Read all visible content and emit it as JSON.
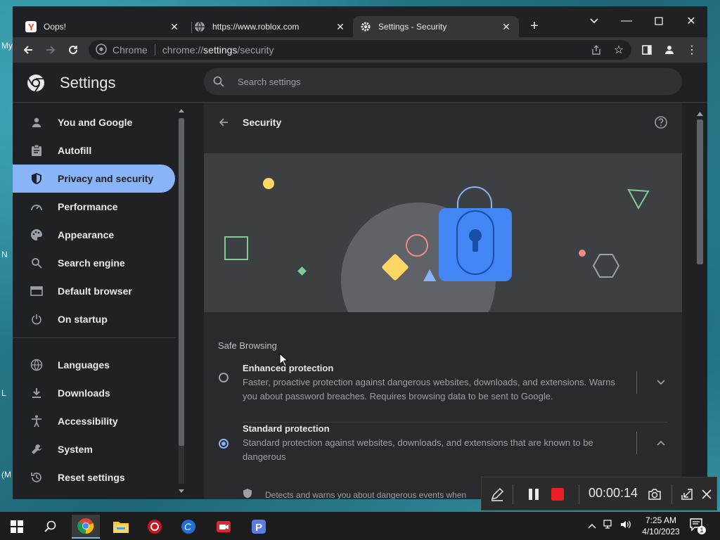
{
  "desktop": {
    "labels": [
      "My",
      "N",
      "L",
      "(M"
    ]
  },
  "tabs": [
    {
      "title": "Oops!",
      "icon": "yandex-icon"
    },
    {
      "title": "https://www.roblox.com",
      "icon": "globe-icon"
    },
    {
      "title": "Settings - Security",
      "icon": "gear-icon",
      "active": true
    }
  ],
  "omnibox": {
    "chip": "Chrome",
    "url_scheme": "chrome://",
    "url_host": "settings",
    "url_path": "/security"
  },
  "settings": {
    "title": "Settings",
    "search_placeholder": "Search settings"
  },
  "sidebar": {
    "items": [
      {
        "label": "You and Google",
        "icon": "person-icon"
      },
      {
        "label": "Autofill",
        "icon": "clipboard-icon"
      },
      {
        "label": "Privacy and security",
        "icon": "shield-icon",
        "selected": true
      },
      {
        "label": "Performance",
        "icon": "speedometer-icon"
      },
      {
        "label": "Appearance",
        "icon": "palette-icon"
      },
      {
        "label": "Search engine",
        "icon": "search-icon"
      },
      {
        "label": "Default browser",
        "icon": "browser-icon"
      },
      {
        "label": "On startup",
        "icon": "power-icon"
      },
      {
        "label": "Languages",
        "icon": "globe-icon"
      },
      {
        "label": "Downloads",
        "icon": "download-icon"
      },
      {
        "label": "Accessibility",
        "icon": "accessibility-icon"
      },
      {
        "label": "System",
        "icon": "wrench-icon"
      },
      {
        "label": "Reset settings",
        "icon": "reset-icon"
      }
    ]
  },
  "security": {
    "title": "Security",
    "section_label": "Safe Browsing",
    "options": [
      {
        "title": "Enhanced protection",
        "description": "Faster, proactive protection against dangerous websites, downloads, and extensions. Warns you about password breaches. Requires browsing data to be sent to Google.",
        "selected": false,
        "expanded": false
      },
      {
        "title": "Standard protection",
        "description": "Standard protection against websites, downloads, and extensions that are known to be dangerous",
        "selected": true,
        "expanded": true
      }
    ],
    "sub_item": "Detects and warns you about dangerous events when"
  },
  "recorder": {
    "time": "00:00:14"
  },
  "taskbar": {
    "time": "7:25 AM",
    "date": "4/10/2023",
    "notification_count": "1"
  },
  "colors": {
    "accent": "#8ab4f8",
    "background": "#202124",
    "surface": "#292a2d",
    "record_red": "#ea1c24"
  }
}
